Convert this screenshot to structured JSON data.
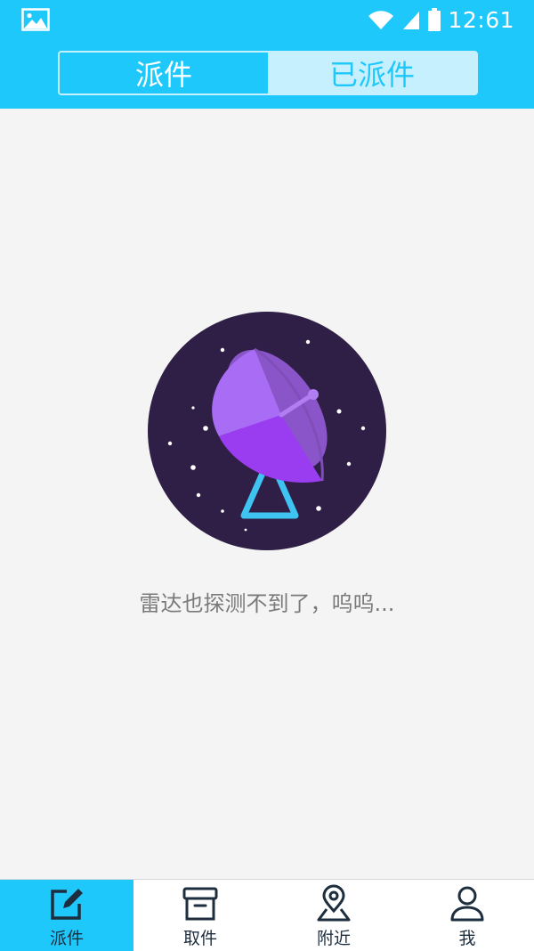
{
  "colors": {
    "primary": "#1ec8fb",
    "segment_inactive_bg": "#c7f0ff",
    "background": "#f4f4f4",
    "nav_text": "#1d2e3e",
    "empty_text": "#7a7a7a"
  },
  "status_bar": {
    "time": "12:61",
    "left_icon": "image-icon",
    "right_icons": [
      "wifi-icon",
      "signal-icon",
      "battery-icon"
    ]
  },
  "segment": {
    "tabs": [
      {
        "label": "派件",
        "active": false
      },
      {
        "label": "已派件",
        "active": true
      }
    ]
  },
  "empty_state": {
    "illustration": "radar-dish-illustration",
    "message": "雷达也探测不到了，呜呜..."
  },
  "bottom_nav": {
    "items": [
      {
        "label": "派件",
        "icon": "edit-icon",
        "active": true
      },
      {
        "label": "取件",
        "icon": "box-icon",
        "active": false
      },
      {
        "label": "附近",
        "icon": "map-pin-icon",
        "active": false
      },
      {
        "label": "我",
        "icon": "user-icon",
        "active": false
      }
    ]
  }
}
